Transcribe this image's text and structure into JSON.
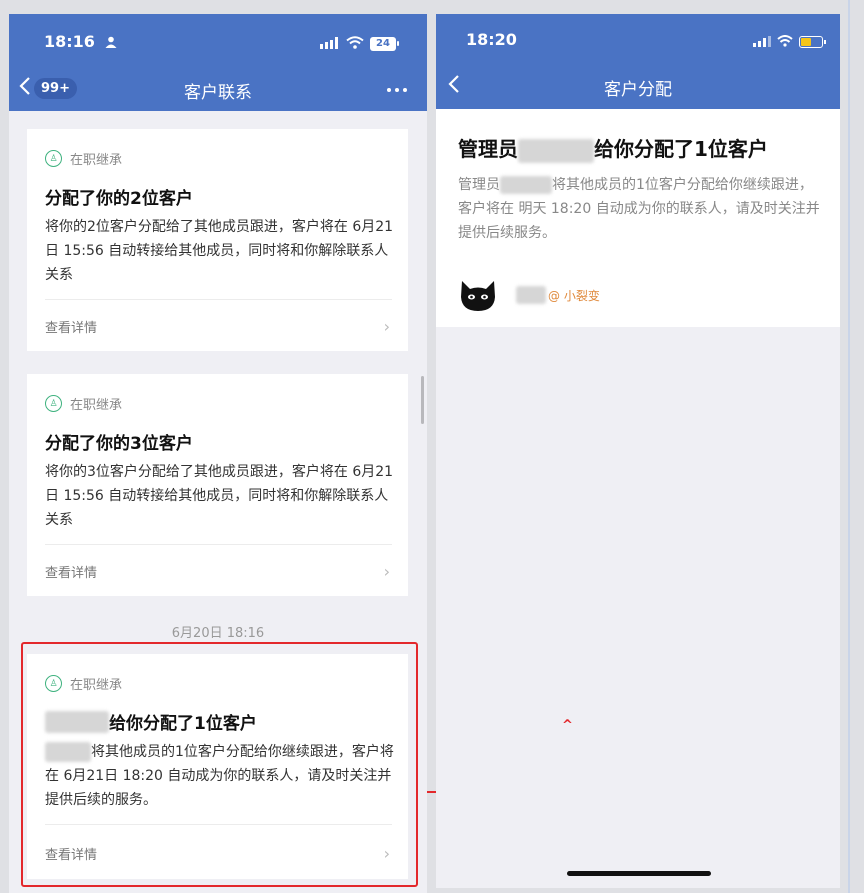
{
  "left_phone": {
    "status_time": "18:16",
    "battery": "24",
    "back_badge": "99+",
    "title": "客户联系",
    "cards": [
      {
        "tag": "在职继承",
        "title": "分配了你的2位客户",
        "body": "将你的2位客户分配给了其他成员跟进，客户将在 6月21日 15:56 自动转接给其他成员，同时将和你解除联系人关系",
        "footer": "查看详情"
      },
      {
        "tag": "在职继承",
        "title": "分配了你的3位客户",
        "body": "将你的3位客户分配给了其他成员跟进，客户将在 6月21日 15:56 自动转接给其他成员，同时将和你解除联系人关系",
        "footer": "查看详情"
      },
      {
        "tag": "在职继承",
        "title": "给你分配了1位客户",
        "body_line1": "将其他成员的1位客户分配给你继续跟",
        "body_rest": "进，客户将在 6月21日 18:20 自动成为你的联系人，请及时关注并提供后续的服务。",
        "footer": "查看详情"
      }
    ],
    "date_separator": "6月20日 18:16"
  },
  "right_phone": {
    "status_time": "18:20",
    "title": "客户分配",
    "heading_prefix": "管理员",
    "heading_suffix": "给你分配了1位客户",
    "body_prefix": "管理员",
    "body_rest": "将其他成员的1位客户分配给你继续跟进，客户将在 明天 18:20 自动成为你的联系人，请及时关注并提供后续服务。",
    "user_suffix": "@ 小裂变"
  },
  "colors": {
    "header_blue": "#4a73c4",
    "tag_green": "#3fb27f",
    "highlight_red": "#e3282c",
    "user_orange": "#e08a3c"
  },
  "icons": [
    "chevron-left-icon",
    "more-icon",
    "wifi-icon",
    "signal-icon",
    "battery-icon",
    "person-icon",
    "tag-icon",
    "chevron-right-icon",
    "cat-avatar-icon",
    "arrow-right-icon"
  ]
}
